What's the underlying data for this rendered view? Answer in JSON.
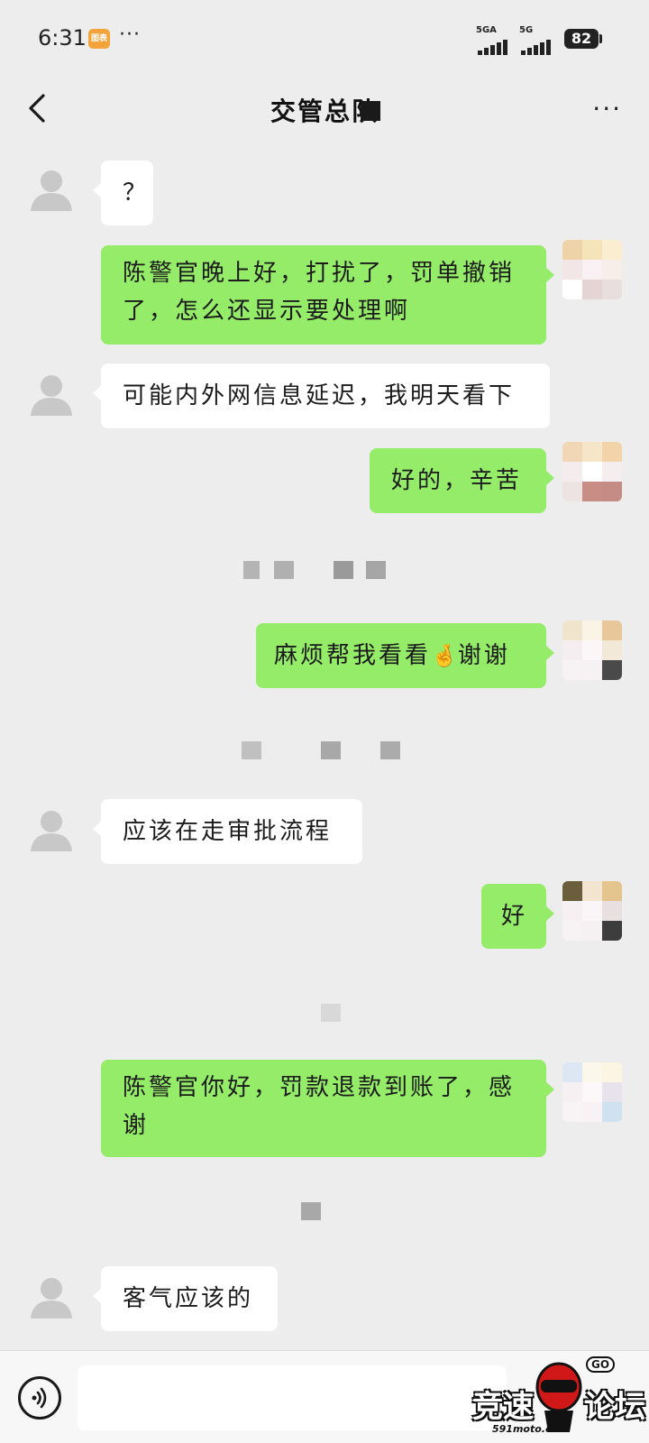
{
  "status_bar": {
    "time": "6:31",
    "app_badge": "图表",
    "more": "···",
    "network1": "5GA",
    "network2": "5G",
    "battery": "82"
  },
  "header": {
    "title": "交管总队",
    "more": "···"
  },
  "messages": [
    {
      "side": "in",
      "text": "？"
    },
    {
      "side": "out",
      "text": "陈警官晚上好，打扰了，罚单撤销了，怎么还显示要处理啊"
    },
    {
      "side": "in",
      "text": "可能内外网信息延迟，我明天看下"
    },
    {
      "side": "out",
      "text": "好的，辛苦"
    },
    {
      "side": "out",
      "text": "麻烦帮我看看",
      "emoji": "🤞",
      "text_after": "谢谢"
    },
    {
      "side": "in",
      "text": "应该在走审批流程"
    },
    {
      "side": "out",
      "text": "好"
    },
    {
      "side": "out",
      "text": "陈警官你好，罚款退款到账了，感谢"
    },
    {
      "side": "in",
      "text": "客气应该的"
    }
  ],
  "input": {
    "placeholder": ""
  },
  "watermark": {
    "text_left": "竞速",
    "text_right": "论坛",
    "url": "591moto.com",
    "go": "GO"
  },
  "colors": {
    "background": "#ededed",
    "incoming_bubble": "#ffffff",
    "outgoing_bubble": "#95ec69"
  }
}
